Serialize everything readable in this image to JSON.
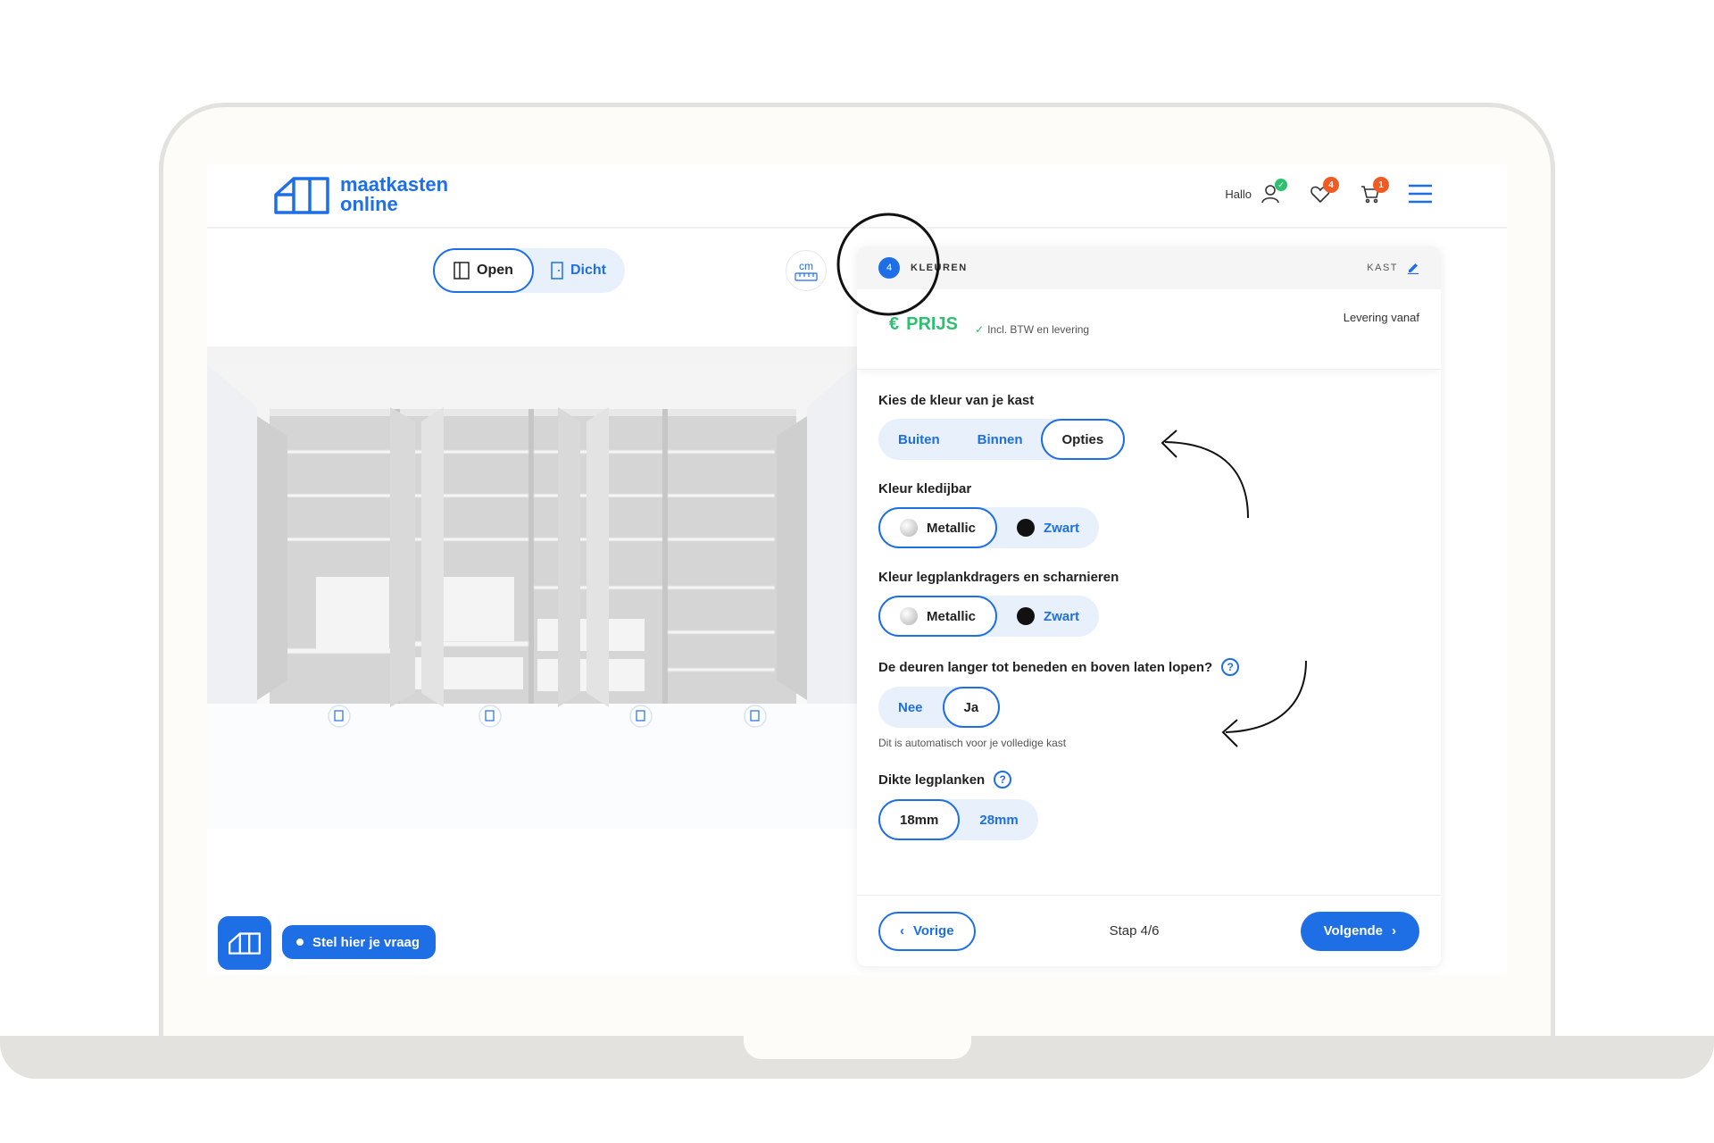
{
  "brand": {
    "line1": "maatkasten",
    "line2": "online",
    "color": "#1e6fe6"
  },
  "header": {
    "greeting": "Hallo",
    "wishlist_count": "4",
    "cart_count": "1"
  },
  "viewer": {
    "toggle": {
      "open_label": "Open",
      "closed_label": "Dicht"
    },
    "unit_label": "cm",
    "help_label": "Stel hier je vraag"
  },
  "panel": {
    "step_number": "4",
    "step_title": "KLEUREN",
    "kast_link": "KAST",
    "price_label": "PRIJS",
    "price_note": "Incl. BTW en levering",
    "delivery": "Levering vanaf",
    "q1": {
      "label": "Kies de kleur van je kast",
      "options": [
        "Buiten",
        "Binnen",
        "Opties"
      ],
      "selected": "Opties"
    },
    "q2": {
      "label": "Kleur kledijbar",
      "options": [
        "Metallic",
        "Zwart"
      ],
      "selected": "Metallic"
    },
    "q3": {
      "label": "Kleur legplankdragers en scharnieren",
      "options": [
        "Metallic",
        "Zwart"
      ],
      "selected": "Metallic"
    },
    "q4": {
      "label": "De deuren langer tot beneden en boven laten lopen?",
      "options": [
        "Nee",
        "Ja"
      ],
      "selected": "Ja",
      "note": "Dit is automatisch voor je volledige kast"
    },
    "q5": {
      "label": "Dikte legplanken",
      "options": [
        "18mm",
        "28mm"
      ],
      "selected": "18mm"
    },
    "footer": {
      "prev_label": "Vorige",
      "step_count": "Stap 4/6",
      "next_label": "Volgende"
    }
  },
  "colors": {
    "accent": "#1e6fe6",
    "price": "#2fbf71",
    "badge": "#f05a23"
  }
}
